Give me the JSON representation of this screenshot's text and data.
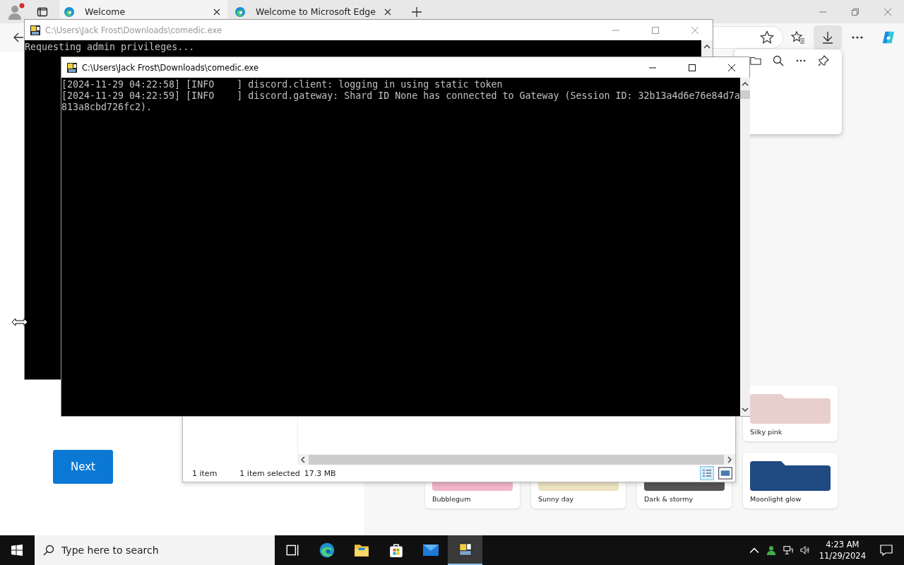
{
  "browser": {
    "tabs": [
      {
        "title": "Welcome",
        "selected": true
      },
      {
        "title": "Welcome to Microsoft Edge",
        "selected": false
      }
    ]
  },
  "welcome": {
    "next_button": "Next",
    "theme_rows": [
      [
        {
          "name": "Silky pink",
          "color": "#e8cfcd"
        }
      ],
      [
        {
          "name": "Bubblegum",
          "color": "#f2b5c9"
        },
        {
          "name": "Sunny day",
          "color": "#ece3c0"
        },
        {
          "name": "Dark & stormy",
          "color": "#555555"
        },
        {
          "name": "Moonlight glow",
          "color": "#1f4a82"
        }
      ]
    ]
  },
  "consoles": [
    {
      "title": "C:\\Users\\Jack Frost\\Downloads\\comedic.exe",
      "active": false,
      "lines": [
        "Requesting admin privileges..."
      ]
    },
    {
      "title": "C:\\Users\\Jack Frost\\Downloads\\comedic.exe",
      "active": true,
      "lines": [
        "[2024-11-29 04:22:58] [INFO    ] discord.client: logging in using static token",
        "[2024-11-29 04:22:59] [INFO    ] discord.gateway: Shard ID None has connected to Gateway (Session ID: 32b13a4d6e76e84d7a",
        "813a8cbd726fc2)."
      ]
    }
  ],
  "explorer": {
    "item_count": "1 item",
    "selection": "1 item selected",
    "size": "17.3 MB"
  },
  "taskbar": {
    "search_placeholder": "Type here to search",
    "apps": [
      {
        "kind": "task-view",
        "selected": false
      },
      {
        "kind": "edge",
        "selected": false
      },
      {
        "kind": "explorer",
        "selected": false
      },
      {
        "kind": "store",
        "selected": false
      },
      {
        "kind": "mail",
        "selected": false
      },
      {
        "kind": "console",
        "selected": true
      }
    ],
    "time": "4:23 AM",
    "date": "11/29/2024"
  }
}
